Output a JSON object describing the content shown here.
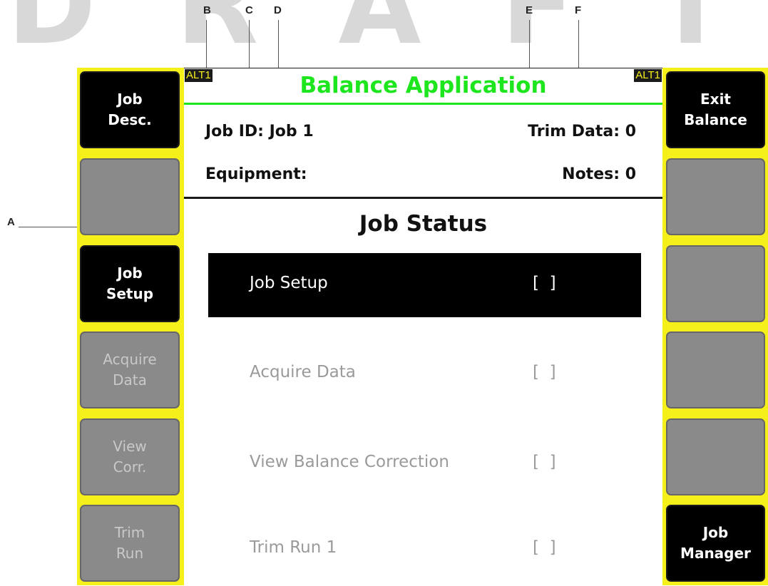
{
  "callouts": {
    "a": "A",
    "b": "B",
    "c": "C",
    "d": "D",
    "e": "E",
    "f": "F"
  },
  "alt_badge": "ALT1",
  "title": "Balance Application",
  "job_id_label": "Job ID:",
  "job_id_value": "Job 1",
  "trim_data_label": "Trim Data:",
  "trim_data_value": "0",
  "equipment_label": "Equipment:",
  "notes_label": "Notes:",
  "notes_value": "0",
  "status_heading": "Job Status",
  "status_items": [
    {
      "label": "Job Setup",
      "check": "[  ]",
      "selected": true
    },
    {
      "label": "Acquire Data",
      "check": "[  ]",
      "selected": false
    },
    {
      "label": "View Balance Correction",
      "check": "[  ]",
      "selected": false
    },
    {
      "label": "Trim Run 1",
      "check": "[  ]",
      "selected": false
    }
  ],
  "left_keys": [
    {
      "label": "Job\nDesc.",
      "state": "active"
    },
    {
      "label": "",
      "state": "empty"
    },
    {
      "label": "Job\nSetup",
      "state": "active"
    },
    {
      "label": "Acquire\nData",
      "state": "disabled"
    },
    {
      "label": "View\nCorr.",
      "state": "disabled"
    },
    {
      "label": "Trim\nRun",
      "state": "disabled"
    }
  ],
  "right_keys": [
    {
      "label": "Exit\nBalance",
      "state": "active"
    },
    {
      "label": "",
      "state": "empty"
    },
    {
      "label": "",
      "state": "empty"
    },
    {
      "label": "",
      "state": "empty"
    },
    {
      "label": "",
      "state": "empty"
    },
    {
      "label": "Job\nManager",
      "state": "active"
    }
  ],
  "colors": {
    "title_green": "#1ee61e",
    "bezel_yellow": "#f5ef1a"
  }
}
